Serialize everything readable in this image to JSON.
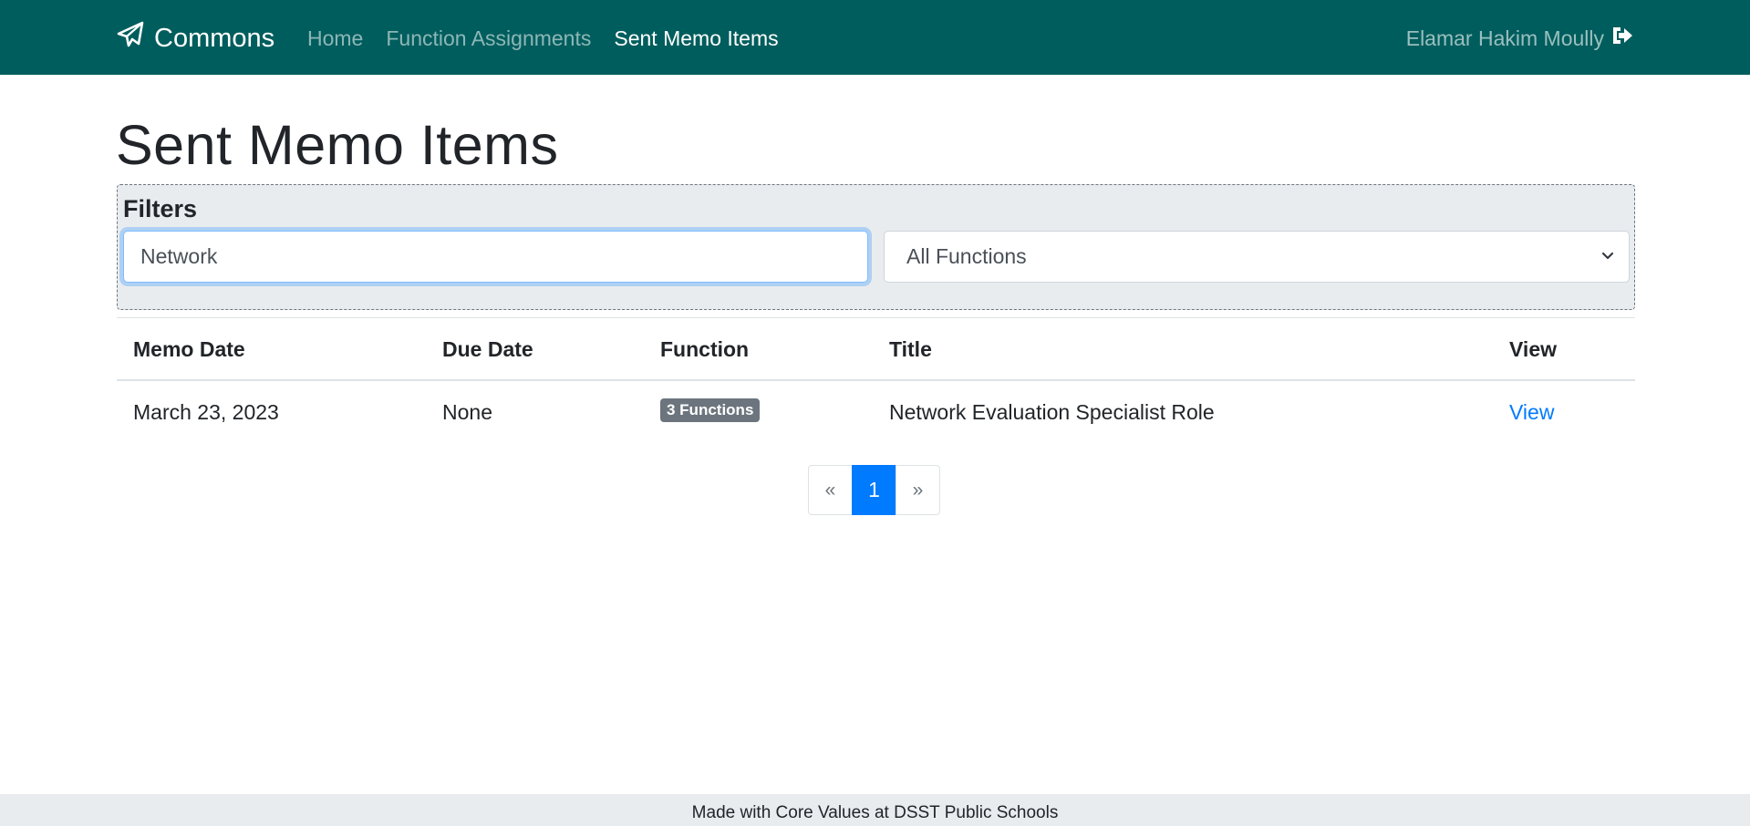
{
  "navbar": {
    "brand": "Commons",
    "links": [
      {
        "label": "Home",
        "active": false
      },
      {
        "label": "Function Assignments",
        "active": false
      },
      {
        "label": "Sent Memo Items",
        "active": true
      }
    ],
    "user_name": "Elamar Hakim Moully",
    "background_color": "#005d5d",
    "brand_icon": "paper-plane-icon",
    "logout_icon": "sign-out-icon"
  },
  "page": {
    "title": "Sent Memo Items"
  },
  "filters": {
    "heading": "Filters",
    "search_value": "Network",
    "function_select": {
      "selected": "All Functions"
    }
  },
  "table": {
    "columns": [
      "Memo Date",
      "Due Date",
      "Function",
      "Title",
      "View"
    ],
    "rows": [
      {
        "memo_date": "March 23, 2023",
        "due_date": "None",
        "function_badge": "3 Functions",
        "title": "Network Evaluation Specialist Role",
        "view_label": "View"
      }
    ]
  },
  "pagination": {
    "prev": "«",
    "current": "1",
    "next": "»",
    "active_color": "#007bff"
  },
  "footer": {
    "text": "Made with Core Values at DSST Public Schools"
  }
}
